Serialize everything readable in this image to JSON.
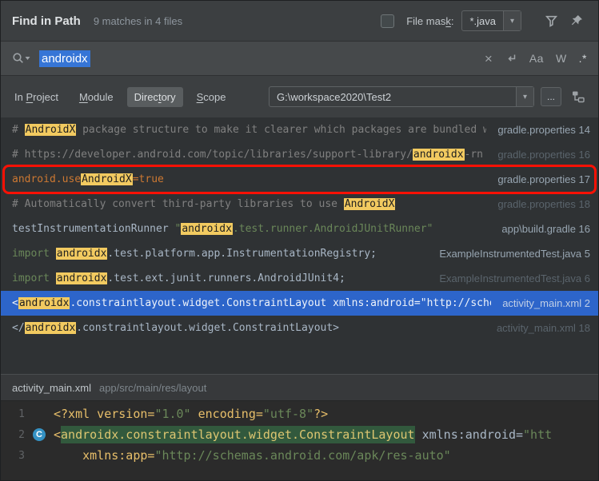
{
  "header": {
    "title": "Find in Path",
    "summary": "9 matches in 4 files",
    "file_mask": {
      "pre": "File mas",
      "mn": "k",
      "post": ":"
    },
    "file_mask_checked": false,
    "file_mask_value": "*.java"
  },
  "search": {
    "query": "androidx",
    "toggles": {
      "match_case": "Aa",
      "words": "W",
      "regex": ".*"
    }
  },
  "scope": {
    "tabs": [
      {
        "pre": "In ",
        "mn": "P",
        "post": "roject",
        "selected": false
      },
      {
        "pre": "",
        "mn": "M",
        "post": "odule",
        "selected": false
      },
      {
        "pre": "Direc",
        "mn": "t",
        "post": "ory",
        "selected": true
      },
      {
        "pre": "",
        "mn": "S",
        "post": "cope",
        "selected": false
      }
    ],
    "path": "G:\\workspace2020\\Test2",
    "browse": "..."
  },
  "results": [
    {
      "segments": [
        [
          "comment",
          "# "
        ],
        [
          "match",
          "AndroidX"
        ],
        [
          "comment",
          " package structure to make it clearer which packages are bundled wi"
        ]
      ],
      "file": "gradle.properties",
      "line": "14",
      "dim": false,
      "selected": false,
      "annotated": false
    },
    {
      "segments": [
        [
          "comment",
          "# https://developer.android.com/topic/libraries/support-library/"
        ],
        [
          "match",
          "androidx"
        ],
        [
          "comment",
          "-rn"
        ]
      ],
      "file": "gradle.properties",
      "line": "16",
      "dim": true,
      "selected": false,
      "annotated": false
    },
    {
      "segments": [
        [
          "orange",
          "android.use"
        ],
        [
          "match",
          "AndroidX"
        ],
        [
          "orange",
          "=true"
        ]
      ],
      "file": "gradle.properties",
      "line": "17",
      "dim": false,
      "selected": false,
      "annotated": true
    },
    {
      "segments": [
        [
          "comment",
          "# Automatically convert third-party libraries to use "
        ],
        [
          "match",
          "AndroidX"
        ]
      ],
      "file": "gradle.properties",
      "line": "18",
      "dim": true,
      "selected": false,
      "annotated": false
    },
    {
      "segments": [
        [
          "plain",
          "testInstrumentationRunner "
        ],
        [
          "str",
          "\""
        ],
        [
          "match",
          "androidx"
        ],
        [
          "str",
          ".test.runner.AndroidJUnitRunner\""
        ]
      ],
      "file": "app\\build.gradle",
      "line": "16",
      "dim": false,
      "selected": false,
      "annotated": false
    },
    {
      "segments": [
        [
          "kw",
          "import "
        ],
        [
          "match",
          "androidx"
        ],
        [
          "plain",
          ".test.platform.app.InstrumentationRegistry;"
        ]
      ],
      "file": "ExampleInstrumentedTest.java",
      "line": "5",
      "dim": false,
      "selected": false,
      "annotated": false
    },
    {
      "segments": [
        [
          "kw",
          "import "
        ],
        [
          "match",
          "androidx"
        ],
        [
          "plain",
          ".test.ext.junit.runners.AndroidJUnit4;"
        ]
      ],
      "file": "ExampleInstrumentedTest.java",
      "line": "6",
      "dim": true,
      "selected": false,
      "annotated": false
    },
    {
      "segments": [
        [
          "sel",
          "<"
        ],
        [
          "match",
          "androidx"
        ],
        [
          "sel",
          ".constraintlayout.widget.ConstraintLayout xmlns:android=\"http://scher"
        ]
      ],
      "file": "activity_main.xml",
      "line": "2",
      "dim": false,
      "selected": true,
      "annotated": false
    },
    {
      "segments": [
        [
          "plain",
          "</"
        ],
        [
          "match",
          "androidx"
        ],
        [
          "plain",
          ".constraintlayout.widget.ConstraintLayout>"
        ]
      ],
      "file": "activity_main.xml",
      "line": "18",
      "dim": true,
      "selected": false,
      "annotated": false
    }
  ],
  "preview": {
    "file": "activity_main.xml",
    "path": "app/src/main/res/layout"
  },
  "editor": {
    "lines": [
      {
        "num": "1",
        "icon": null,
        "segments": [
          [
            "tag",
            "<?xml version="
          ],
          [
            "strE",
            "\"1.0\""
          ],
          [
            "tag",
            " encoding="
          ],
          [
            "strE",
            "\"utf-8\""
          ],
          [
            "tag",
            "?>"
          ]
        ]
      },
      {
        "num": "2",
        "icon": "C",
        "segments": [
          [
            "tag",
            "<"
          ],
          [
            "hl",
            "androidx.constraintlayout.widget.ConstraintLayout"
          ],
          [
            "attr",
            " xmlns:android="
          ],
          [
            "strE",
            "\"htt"
          ]
        ]
      },
      {
        "num": "3",
        "icon": null,
        "segments": [
          [
            "plain",
            "    "
          ],
          [
            "attrY",
            "xmlns:app="
          ],
          [
            "strE",
            "\"http://schemas.android.com/apk/res-auto\""
          ]
        ]
      }
    ]
  },
  "icons": {
    "combo_arrow": "▾",
    "clear": "×"
  },
  "colors": {
    "match_highlight": "#f2ca60",
    "selected_row_blue": "#2d65ca",
    "annotation_red": "#fb1105",
    "selected_text_blue": "#3675d6",
    "editor_match_green": "#32593d",
    "gutter_icon_blue": "#3592c4"
  }
}
